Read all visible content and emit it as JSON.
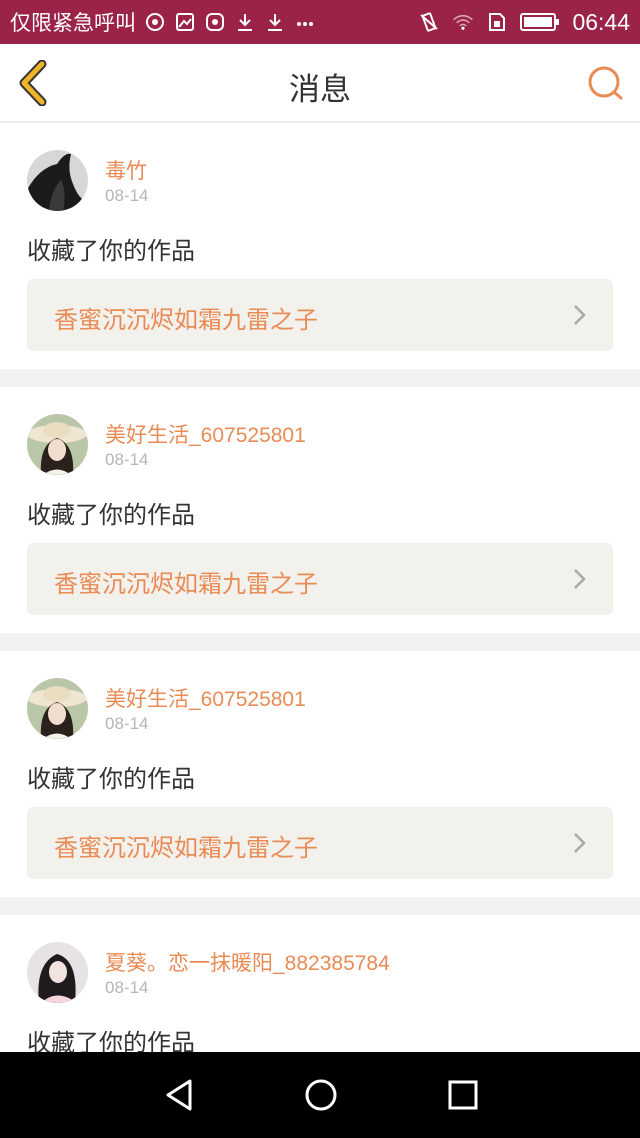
{
  "status_bar": {
    "carrier": "仅限紧急呼叫",
    "time": "06:44",
    "left_icons": [
      "hotspot-icon",
      "gallery-icon",
      "huawei-app-icon",
      "download-icon",
      "download-icon",
      "more-icon"
    ],
    "right_icons": [
      "vibrate-icon",
      "wifi-icon",
      "sim-icon",
      "battery-icon"
    ]
  },
  "header": {
    "title": "消息",
    "back_icon": "back-chevron-icon",
    "search_icon": "search-icon"
  },
  "messages": [
    {
      "user": "毒竹",
      "date": "08-14",
      "action": "收藏了你的作品",
      "work_title": "香蜜沉沉烬如霜九雷之子"
    },
    {
      "user": "美好生活_607525801",
      "date": "08-14",
      "action": "收藏了你的作品",
      "work_title": "香蜜沉沉烬如霜九雷之子"
    },
    {
      "user": "美好生活_607525801",
      "date": "08-14",
      "action": "收藏了你的作品",
      "work_title": "香蜜沉沉烬如霜九雷之子"
    },
    {
      "user": "夏葵。恋一抹暖阳_882385784",
      "date": "08-14",
      "action": "收藏了你的作品",
      "work_title": ""
    }
  ],
  "colors": {
    "status_bar": "#9a2347",
    "accent": "#e98b55",
    "back_icon": "#f0b429",
    "work_bg": "#f3f1ec"
  },
  "nav_bar": {
    "icons": [
      "back-triangle-icon",
      "home-circle-icon",
      "recents-square-icon"
    ]
  }
}
